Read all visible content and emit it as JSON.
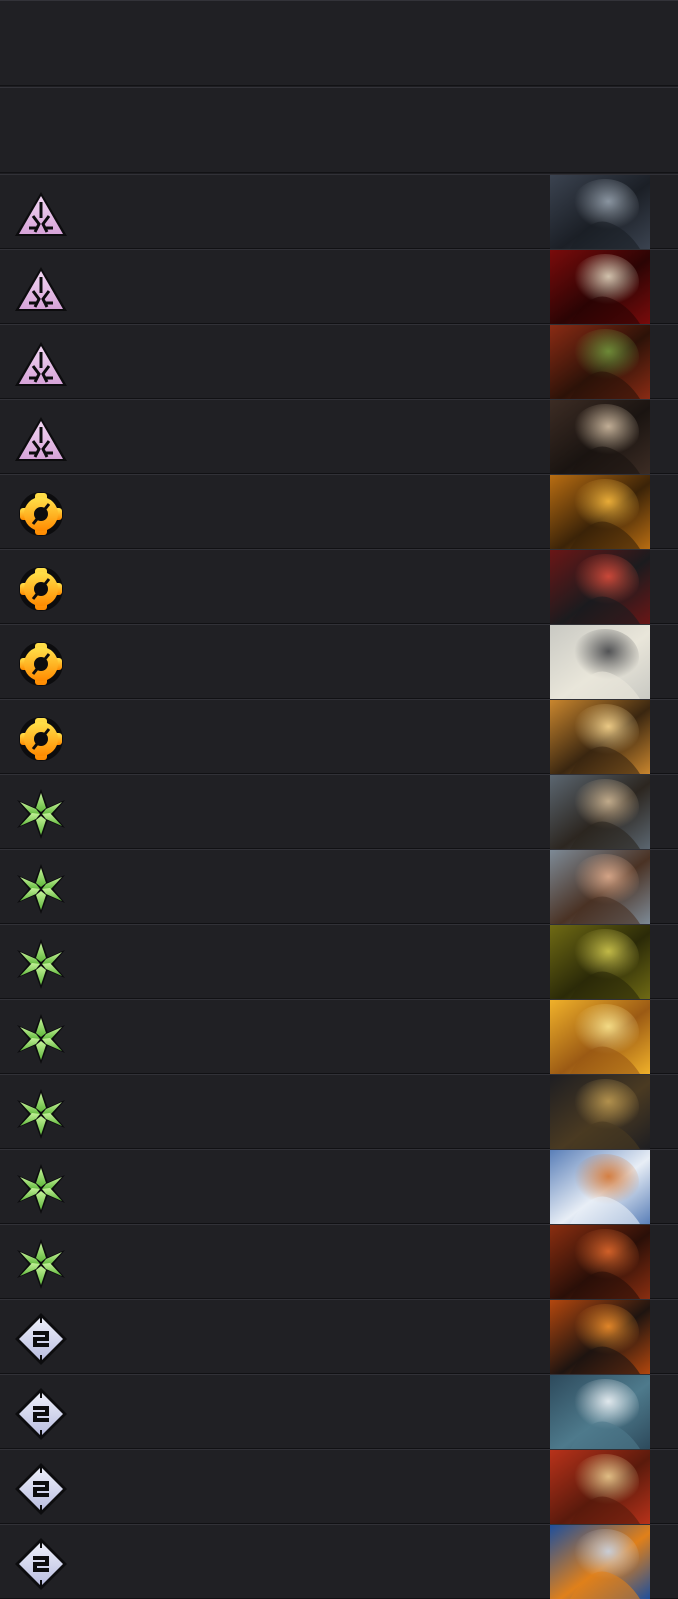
{
  "header": {
    "rows": 2
  },
  "rows": [
    {
      "faction": "triangle-faction-icon",
      "color": "#d6a3d8",
      "art": [
        "#3b4350",
        "#8f9aa6",
        "#1b1f26"
      ]
    },
    {
      "faction": "triangle-faction-icon",
      "color": "#d6a3d8",
      "art": [
        "#7a0b0b",
        "#d9cbb5",
        "#2b0404"
      ]
    },
    {
      "faction": "triangle-faction-icon",
      "color": "#d6a3d8",
      "art": [
        "#8a2b14",
        "#6f8f3a",
        "#2c1208"
      ]
    },
    {
      "faction": "triangle-faction-icon",
      "color": "#d6a3d8",
      "art": [
        "#3c2c24",
        "#c9b59c",
        "#1a1411"
      ]
    },
    {
      "faction": "gear-faction-icon",
      "color": "#ffb300",
      "art": [
        "#b86d12",
        "#f0b23a",
        "#3b2308"
      ]
    },
    {
      "faction": "gear-faction-icon",
      "color": "#ffb300",
      "art": [
        "#6a1616",
        "#d24a3a",
        "#1b1b1e"
      ]
    },
    {
      "faction": "gear-faction-icon",
      "color": "#ffb300",
      "art": [
        "#c9c9c3",
        "#4b4c4f",
        "#e9e6da"
      ]
    },
    {
      "faction": "gear-faction-icon",
      "color": "#ffb300",
      "art": [
        "#c9862e",
        "#f2d08a",
        "#3a2610"
      ]
    },
    {
      "faction": "leaf-faction-icon",
      "color": "#86d15c",
      "art": [
        "#5b6670",
        "#c7b08f",
        "#2c2620"
      ]
    },
    {
      "faction": "leaf-faction-icon",
      "color": "#86d15c",
      "art": [
        "#7d8a96",
        "#d9a88a",
        "#4a3224"
      ]
    },
    {
      "faction": "leaf-faction-icon",
      "color": "#86d15c",
      "art": [
        "#6f6a14",
        "#c8c04a",
        "#2b2a08"
      ]
    },
    {
      "faction": "leaf-faction-icon",
      "color": "#86d15c",
      "art": [
        "#f0b12a",
        "#f7e08a",
        "#9b5a14"
      ]
    },
    {
      "faction": "leaf-faction-icon",
      "color": "#86d15c",
      "art": [
        "#1e1e22",
        "#b7954f",
        "#4a3a22"
      ]
    },
    {
      "faction": "leaf-faction-icon",
      "color": "#86d15c",
      "art": [
        "#5a7fb8",
        "#d47a3a",
        "#e8eef6"
      ]
    },
    {
      "faction": "leaf-faction-icon",
      "color": "#86d15c",
      "art": [
        "#8a2e10",
        "#d8642a",
        "#2a0f08"
      ]
    },
    {
      "faction": "diamond-faction-icon",
      "color": "#b9bde0",
      "art": [
        "#b3470e",
        "#e88a2a",
        "#1e1410"
      ]
    },
    {
      "faction": "diamond-faction-icon",
      "color": "#b9bde0",
      "art": [
        "#2d4a5c",
        "#e8eef2",
        "#4e7a8c"
      ]
    },
    {
      "faction": "diamond-faction-icon",
      "color": "#b9bde0",
      "art": [
        "#b8321a",
        "#e6c58a",
        "#5a1a0c"
      ]
    },
    {
      "faction": "diamond-faction-icon",
      "color": "#b9bde0",
      "art": [
        "#1e4f9c",
        "#c9d1de",
        "#e0801a"
      ]
    }
  ]
}
